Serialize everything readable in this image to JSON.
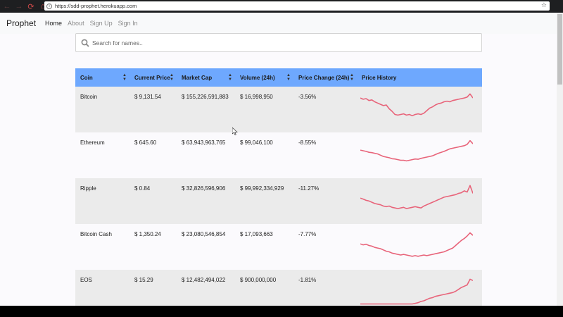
{
  "browser": {
    "url": "https://sdd-prophet.herokuapp.com"
  },
  "navbar": {
    "brand": "Prophet",
    "links": [
      "Home",
      "About",
      "Sign Up",
      "Sign In"
    ]
  },
  "search": {
    "placeholder": "Search for names.."
  },
  "table": {
    "headers": [
      "Coin",
      "Current Price",
      "Market Cap",
      "Volume (24h)",
      "Price Change (24h)",
      "Price History"
    ],
    "rows": [
      {
        "coin": "Bitcoin",
        "price": "$ 9,131.54",
        "market_cap": "$ 155,226,591,883",
        "volume": "$ 16,998,950",
        "change": "-3.56%",
        "history": [
          0.82,
          0.78,
          0.8,
          0.74,
          0.76,
          0.7,
          0.66,
          0.62,
          0.58,
          0.6,
          0.48,
          0.4,
          0.3,
          0.28,
          0.3,
          0.32,
          0.28,
          0.3,
          0.26,
          0.3,
          0.32,
          0.3,
          0.34,
          0.42,
          0.5,
          0.54,
          0.6,
          0.64,
          0.66,
          0.7,
          0.72,
          0.7,
          0.74,
          0.76,
          0.78,
          0.8,
          0.82,
          0.85,
          0.95,
          0.82
        ]
      },
      {
        "coin": "Ethereum",
        "price": "$ 645.60",
        "market_cap": "$ 63,943,963,765",
        "volume": "$ 99,046,100",
        "change": "-8.55%",
        "history": [
          0.62,
          0.6,
          0.58,
          0.55,
          0.54,
          0.52,
          0.5,
          0.46,
          0.42,
          0.4,
          0.38,
          0.35,
          0.34,
          0.32,
          0.3,
          0.3,
          0.28,
          0.3,
          0.32,
          0.34,
          0.33,
          0.36,
          0.38,
          0.4,
          0.42,
          0.44,
          0.48,
          0.52,
          0.55,
          0.58,
          0.62,
          0.66,
          0.68,
          0.7,
          0.72,
          0.74,
          0.76,
          0.8,
          0.92,
          0.82
        ]
      },
      {
        "coin": "Ripple",
        "price": "$ 0.84",
        "market_cap": "$ 32,826,596,906",
        "volume": "$ 99,992,334,929",
        "change": "-11.27%",
        "history": [
          0.55,
          0.52,
          0.48,
          0.46,
          0.42,
          0.38,
          0.36,
          0.34,
          0.3,
          0.28,
          0.3,
          0.26,
          0.24,
          0.22,
          0.24,
          0.26,
          0.22,
          0.24,
          0.26,
          0.28,
          0.26,
          0.24,
          0.3,
          0.34,
          0.38,
          0.42,
          0.46,
          0.5,
          0.54,
          0.58,
          0.6,
          0.62,
          0.64,
          0.66,
          0.7,
          0.72,
          0.78,
          0.74,
          0.95,
          0.7
        ]
      },
      {
        "coin": "Bitcoin Cash",
        "price": "$ 1,350.24",
        "market_cap": "$ 23,080,546,854",
        "volume": "$ 17,093,663",
        "change": "-7.77%",
        "history": [
          0.55,
          0.52,
          0.54,
          0.5,
          0.48,
          0.44,
          0.42,
          0.4,
          0.36,
          0.32,
          0.3,
          0.26,
          0.24,
          0.22,
          0.2,
          0.22,
          0.2,
          0.18,
          0.16,
          0.18,
          0.16,
          0.18,
          0.2,
          0.18,
          0.2,
          0.22,
          0.24,
          0.26,
          0.28,
          0.3,
          0.34,
          0.38,
          0.42,
          0.5,
          0.58,
          0.66,
          0.72,
          0.8,
          0.9,
          0.82
        ]
      },
      {
        "coin": "EOS",
        "price": "$ 15.29",
        "market_cap": "$ 12,482,494,022",
        "volume": "$ 900,000,000",
        "change": "-1.81%",
        "history": [
          0.1,
          0.1,
          0.1,
          0.1,
          0.1,
          0.1,
          0.1,
          0.1,
          0.1,
          0.1,
          0.1,
          0.1,
          0.1,
          0.1,
          0.1,
          0.1,
          0.1,
          0.1,
          0.1,
          0.12,
          0.14,
          0.18,
          0.2,
          0.24,
          0.28,
          0.3,
          0.34,
          0.36,
          0.38,
          0.4,
          0.42,
          0.44,
          0.46,
          0.5,
          0.56,
          0.62,
          0.66,
          0.7,
          0.88,
          0.84
        ]
      }
    ]
  },
  "colors": {
    "header_bg": "#6ea8fe",
    "spark": "#e8647a",
    "row_alt": "#ebebeb"
  }
}
